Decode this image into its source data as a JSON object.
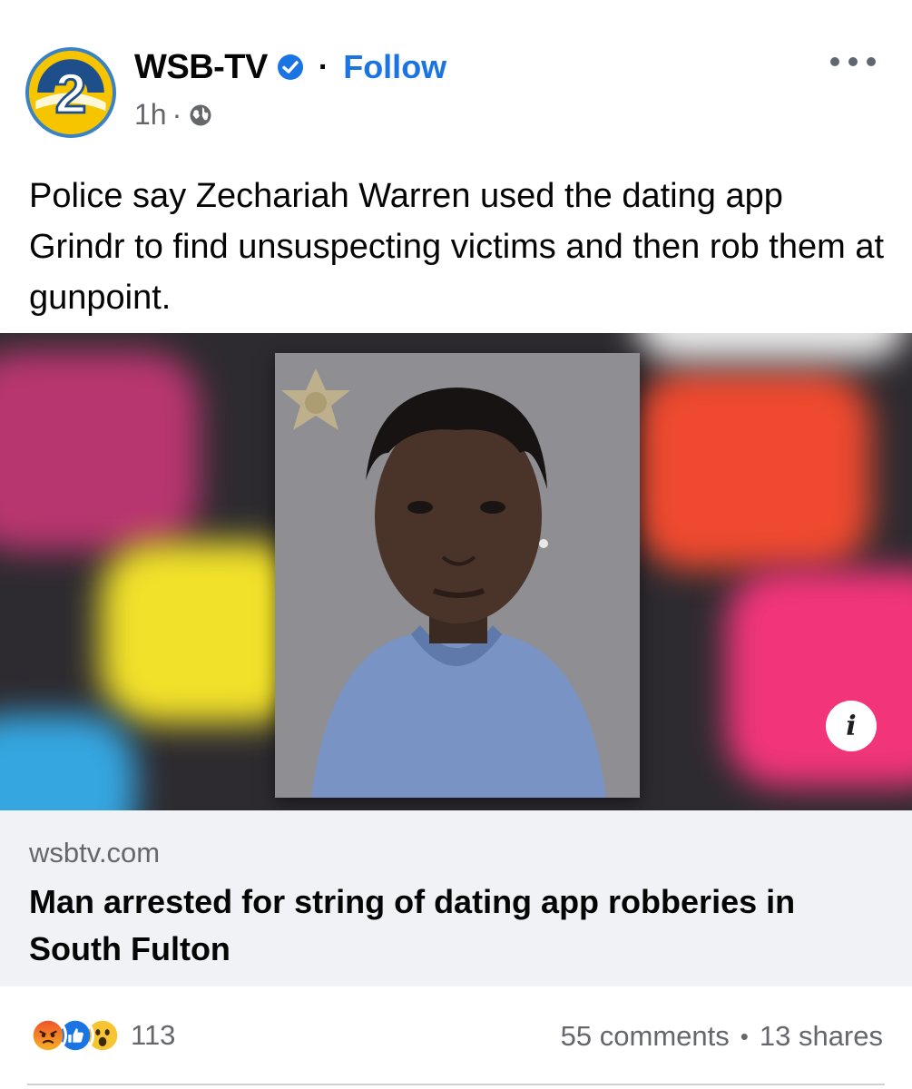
{
  "post": {
    "page_name": "WSB-TV",
    "follow_label": "Follow",
    "separator": "·",
    "timestamp": "1h",
    "time_separator": "·",
    "audience_icon": "globe-icon",
    "more_icon": "more-options-icon",
    "verified_icon": "verified-badge-icon",
    "caption": "Police say Zechariah Warren used the dating app Grindr to find unsuspecting victims and then rob them at gunpoint."
  },
  "avatar": {
    "logo_text": "2"
  },
  "media": {
    "info_label": "i"
  },
  "link_preview": {
    "domain": "wsbtv.com",
    "headline": "Man arrested for string of dating app robberies in South Fulton"
  },
  "engagement": {
    "reaction_icons": [
      "angry-reaction-icon",
      "like-reaction-icon",
      "wow-reaction-icon"
    ],
    "reaction_count": "113",
    "comments": "55 comments",
    "dot": "•",
    "shares": "13 shares"
  },
  "colors": {
    "brand_blue": "#1b74e4",
    "secondary_text": "#65676b",
    "link_background": "#f0f2f5"
  }
}
